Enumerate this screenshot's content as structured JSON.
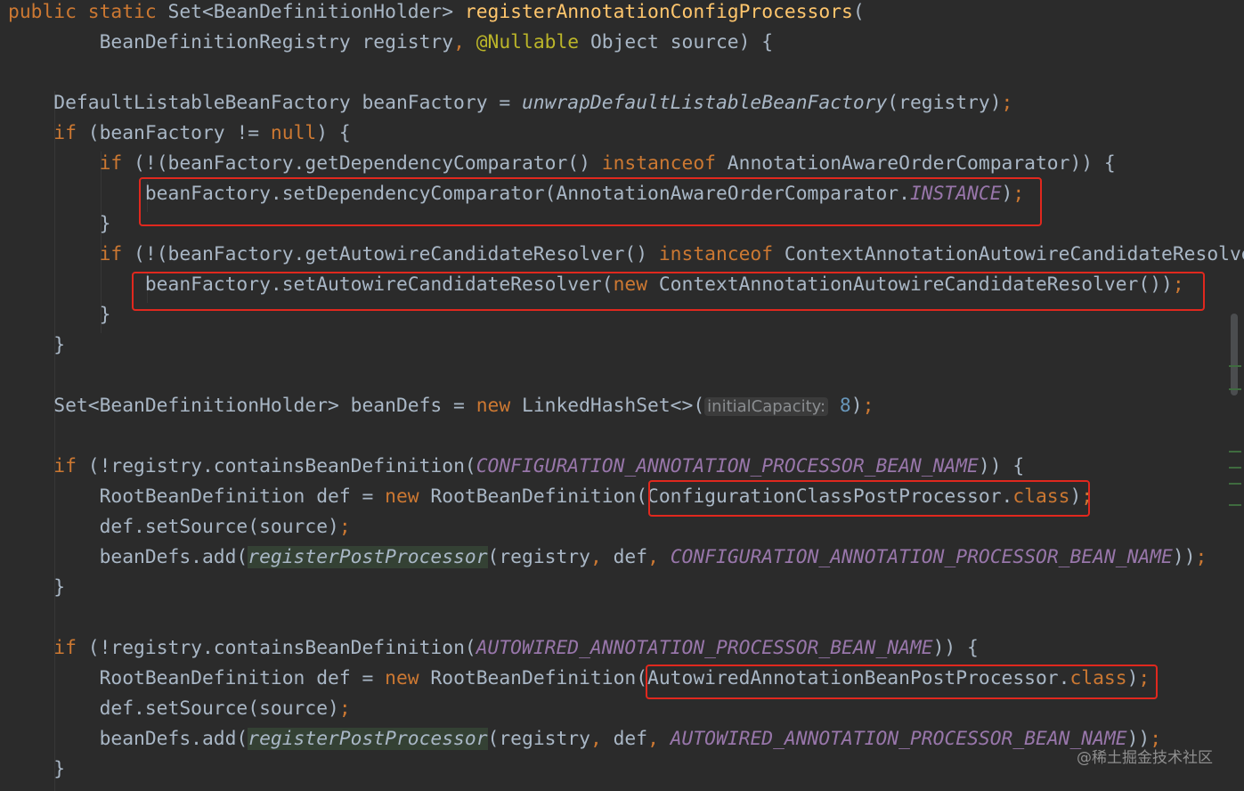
{
  "lines": [
    [
      {
        "t": "public static ",
        "c": "kw"
      },
      {
        "t": "Set<BeanDefinitionHolder> "
      },
      {
        "t": "registerAnnotationConfigProcessors",
        "c": "fn"
      },
      {
        "t": "("
      }
    ],
    [
      {
        "t": "        BeanDefinitionRegistry registry"
      },
      {
        "t": ", ",
        "c": "kw"
      },
      {
        "t": "@Nullable",
        "c": "ann"
      },
      {
        "t": " Object source) {"
      }
    ],
    [],
    [
      {
        "t": "    DefaultListableBeanFactory beanFactory = "
      },
      {
        "t": "unwrapDefaultListableBeanFactory",
        "c": "static"
      },
      {
        "t": "(registry)"
      },
      {
        "t": ";",
        "c": "kw"
      }
    ],
    [
      {
        "t": "    "
      },
      {
        "t": "if ",
        "c": "kw"
      },
      {
        "t": "(beanFactory != "
      },
      {
        "t": "null",
        "c": "kw"
      },
      {
        "t": ") {"
      }
    ],
    [
      {
        "t": "        "
      },
      {
        "t": "if ",
        "c": "kw"
      },
      {
        "t": "(!(beanFactory.getDependencyComparator() "
      },
      {
        "t": "instanceof ",
        "c": "kw"
      },
      {
        "t": "AnnotationAwareOrderComparator)) {"
      }
    ],
    [
      {
        "t": "            beanFactory.setDependencyComparator(AnnotationAwareOrderComparator."
      },
      {
        "t": "INSTANCE",
        "c": "const"
      },
      {
        "t": ")"
      },
      {
        "t": ";",
        "c": "kw"
      }
    ],
    [
      {
        "t": "        }"
      }
    ],
    [
      {
        "t": "        "
      },
      {
        "t": "if ",
        "c": "kw"
      },
      {
        "t": "(!(beanFactory.getAutowireCandidateResolver() "
      },
      {
        "t": "instanceof ",
        "c": "kw"
      },
      {
        "t": "ContextAnnotationAutowireCandidateResolver)) {"
      }
    ],
    [
      {
        "t": "            beanFactory.setAutowireCandidateResolver("
      },
      {
        "t": "new ",
        "c": "kw"
      },
      {
        "t": "ContextAnnotationAutowireCandidateResolver())"
      },
      {
        "t": ";",
        "c": "kw"
      }
    ],
    [
      {
        "t": "        }"
      }
    ],
    [
      {
        "t": "    }"
      }
    ],
    [],
    [
      {
        "t": "    Set<BeanDefinitionHolder> beanDefs = "
      },
      {
        "t": "new ",
        "c": "kw"
      },
      {
        "t": "LinkedHashSet<>("
      },
      {
        "t": "initialCapacity:",
        "c": "hint"
      },
      {
        "t": " "
      },
      {
        "t": "8",
        "c": "num"
      },
      {
        "t": ")"
      },
      {
        "t": ";",
        "c": "kw"
      }
    ],
    [],
    [
      {
        "t": "    "
      },
      {
        "t": "if ",
        "c": "kw"
      },
      {
        "t": "(!registry.containsBeanDefinition("
      },
      {
        "t": "CONFIGURATION_ANNOTATION_PROCESSOR_BEAN_NAME",
        "c": "const"
      },
      {
        "t": ")) {"
      }
    ],
    [
      {
        "t": "        RootBeanDefinition def = "
      },
      {
        "t": "new ",
        "c": "kw"
      },
      {
        "t": "RootBeanDefinition(ConfigurationClassPostProcessor."
      },
      {
        "t": "class",
        "c": "kw"
      },
      {
        "t": ")"
      },
      {
        "t": ";",
        "c": "kw"
      }
    ],
    [
      {
        "t": "        def.setSource(source)"
      },
      {
        "t": ";",
        "c": "kw"
      }
    ],
    [
      {
        "t": "        beanDefs.add("
      },
      {
        "t": "registerPostProcessor",
        "c": "hl"
      },
      {
        "t": "(registry"
      },
      {
        "t": ", ",
        "c": "kw"
      },
      {
        "t": "def"
      },
      {
        "t": ", ",
        "c": "kw"
      },
      {
        "t": "CONFIGURATION_ANNOTATION_PROCESSOR_BEAN_NAME",
        "c": "const"
      },
      {
        "t": "))"
      },
      {
        "t": ";",
        "c": "kw"
      }
    ],
    [
      {
        "t": "    }"
      }
    ],
    [],
    [
      {
        "t": "    "
      },
      {
        "t": "if ",
        "c": "kw"
      },
      {
        "t": "(!registry.containsBeanDefinition("
      },
      {
        "t": "AUTOWIRED_ANNOTATION_PROCESSOR_BEAN_NAME",
        "c": "const"
      },
      {
        "t": ")) {"
      }
    ],
    [
      {
        "t": "        RootBeanDefinition def = "
      },
      {
        "t": "new ",
        "c": "kw"
      },
      {
        "t": "RootBeanDefinition(AutowiredAnnotationBeanPostProcessor."
      },
      {
        "t": "class",
        "c": "kw"
      },
      {
        "t": ")"
      },
      {
        "t": ";",
        "c": "kw"
      }
    ],
    [
      {
        "t": "        def.setSource(source)"
      },
      {
        "t": ";",
        "c": "kw"
      }
    ],
    [
      {
        "t": "        beanDefs.add("
      },
      {
        "t": "registerPostProcessor",
        "c": "hl"
      },
      {
        "t": "(registry"
      },
      {
        "t": ", ",
        "c": "kw"
      },
      {
        "t": "def"
      },
      {
        "t": ", ",
        "c": "kw"
      },
      {
        "t": "AUTOWIRED_ANNOTATION_PROCESSOR_BEAN_NAME",
        "c": "const"
      },
      {
        "t": "))"
      },
      {
        "t": ";",
        "c": "kw"
      }
    ],
    [
      {
        "t": "    }"
      }
    ]
  ],
  "colors": {
    "background": "#2b2b2b",
    "default": "#a9b7c6",
    "keyword": "#cc7832",
    "method_declaration": "#ffc66d",
    "annotation": "#bbb529",
    "constant": "#9876aa",
    "number": "#6897bb",
    "highlight_box": "#e0281e"
  },
  "watermark": "@稀土掘金技术社区"
}
